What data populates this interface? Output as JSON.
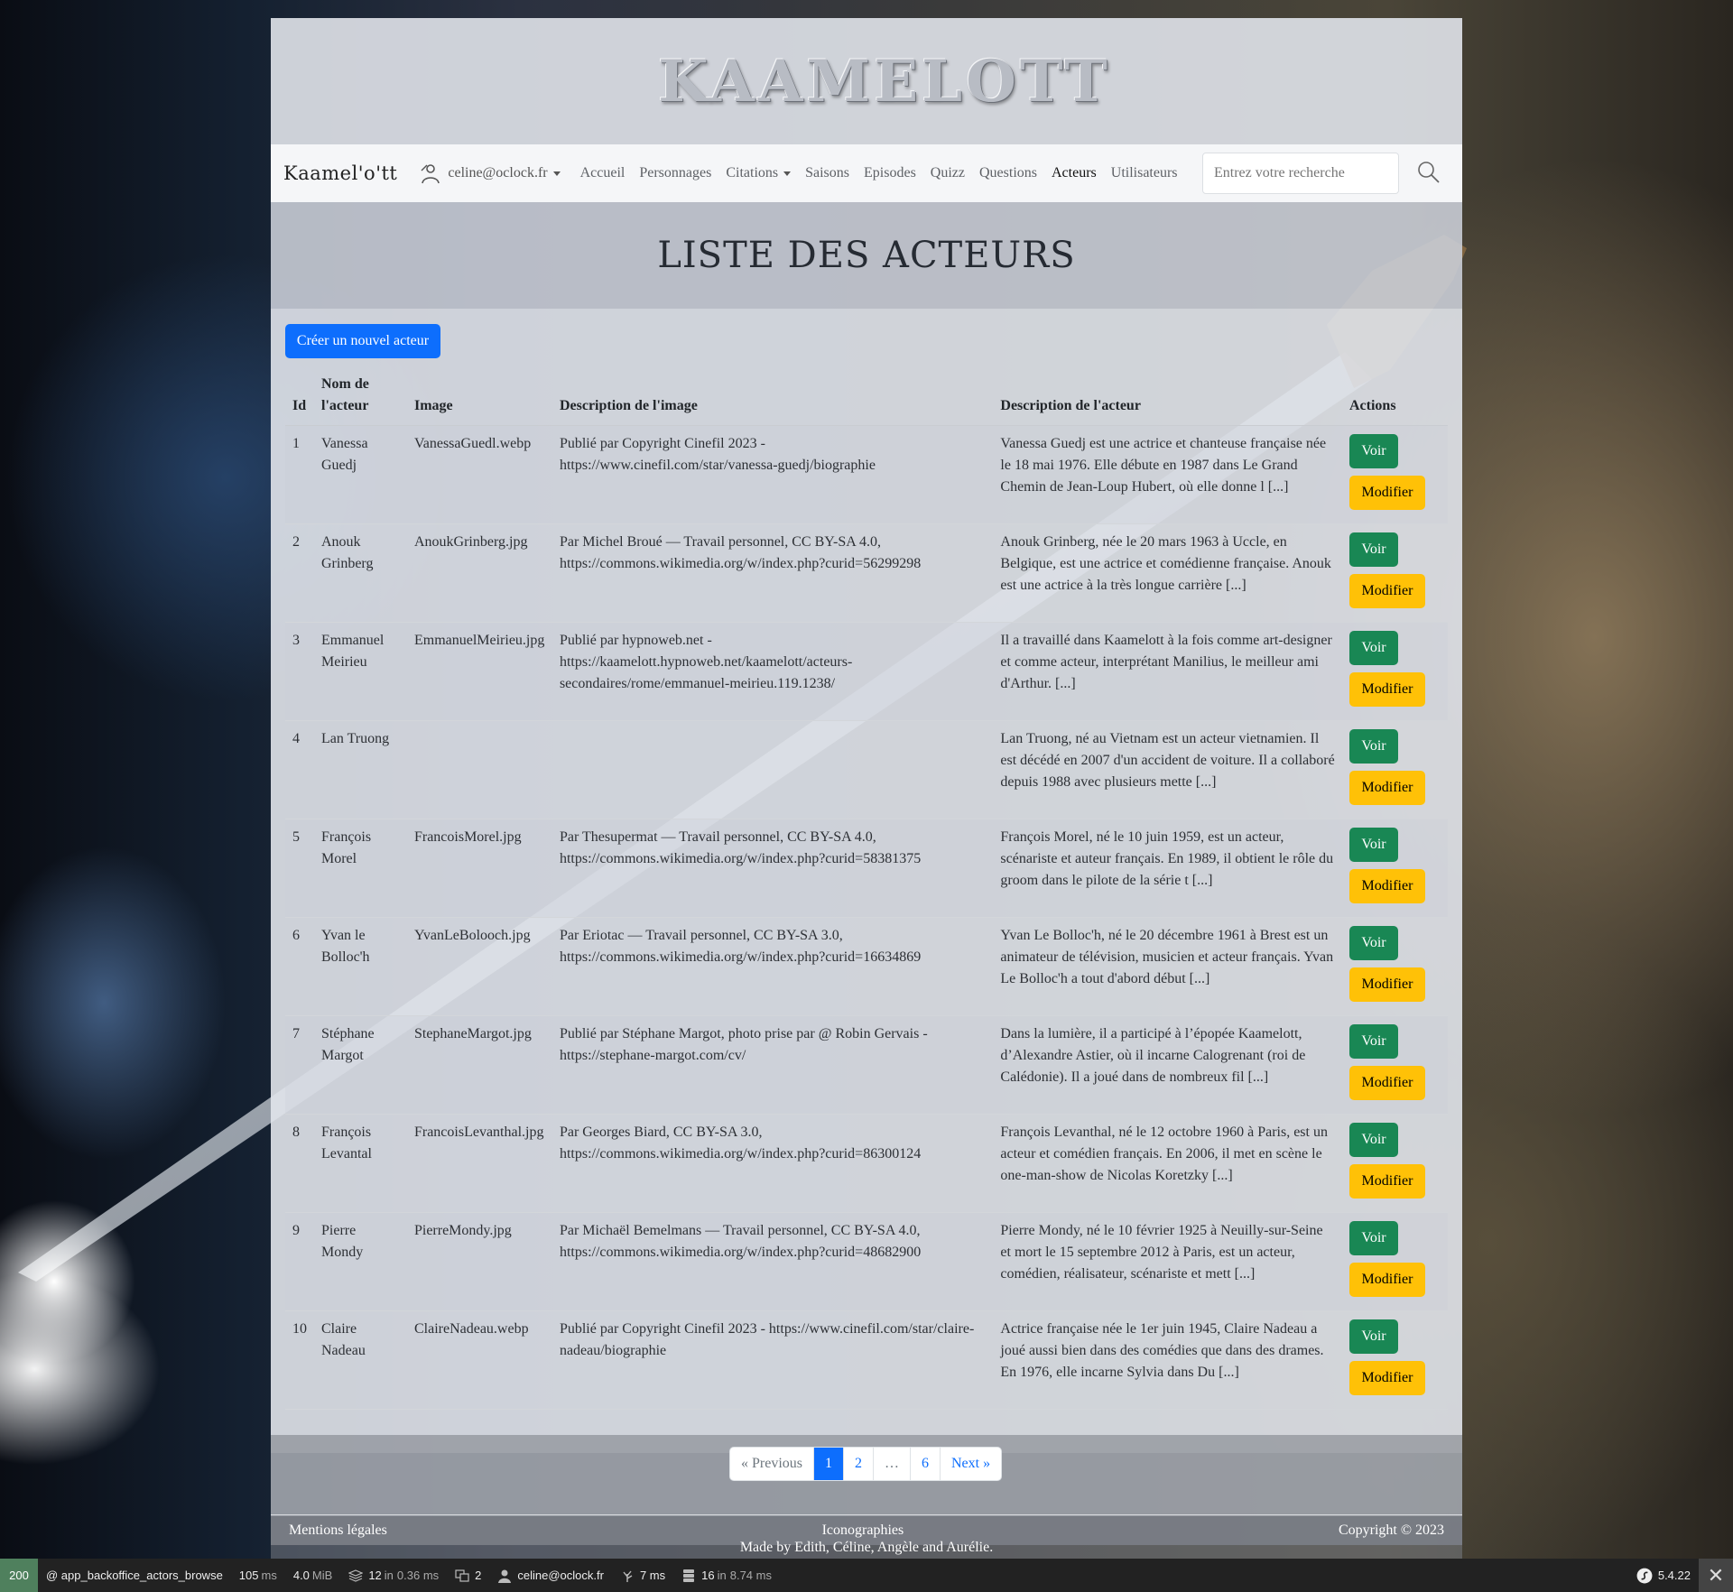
{
  "brand": {
    "logo_text": "KAAMELOTT",
    "nav_brand": "Kaamel'o'tt"
  },
  "navbar": {
    "user_email": "celine@oclock.fr",
    "links": [
      "Accueil",
      "Personnages",
      "Citations",
      "Saisons",
      "Episodes",
      "Quizz",
      "Questions",
      "Acteurs",
      "Utilisateurs"
    ],
    "active": "Acteurs",
    "search_placeholder": "Entrez votre recherche"
  },
  "page": {
    "title": "Liste des acteurs",
    "create_button": "Créer un nouvel acteur"
  },
  "table": {
    "headers": [
      "Id",
      "Nom de l'acteur",
      "Image",
      "Description de l'image",
      "Description de l'acteur",
      "Actions"
    ],
    "rows": [
      {
        "id": "1",
        "name": "Vanessa Guedj",
        "image": "VanessaGuedl.webp",
        "image_desc": "Publié par Copyright Cinefil 2023 - https://www.cinefil.com/star/vanessa-guedj/biographie",
        "desc": "Vanessa Guedj est une actrice et chanteuse française née le 18 mai 1976. Elle débute en 1987 dans Le Grand Chemin de Jean-Loup Hubert, où elle donne l [...]"
      },
      {
        "id": "2",
        "name": "Anouk Grinberg",
        "image": "AnoukGrinberg.jpg",
        "image_desc": "Par Michel Broué — Travail personnel, CC BY-SA 4.0, https://commons.wikimedia.org/w/index.php?curid=56299298",
        "desc": "Anouk Grinberg, née le 20 mars 1963 à Uccle, en Belgique, est une actrice et comédienne française. Anouk est une actrice à la très longue carrière [...]"
      },
      {
        "id": "3",
        "name": "Emmanuel Meirieu",
        "image": "EmmanuelMeirieu.jpg",
        "image_desc": "Publié par hypnoweb.net - https://kaamelott.hypnoweb.net/kaamelott/acteurs-secondaires/rome/emmanuel-meirieu.119.1238/",
        "desc": "Il a travaillé dans Kaamelott à la fois comme art-designer et comme acteur, interprétant Manilius, le meilleur ami d'Arthur. [...]"
      },
      {
        "id": "4",
        "name": "Lan Truong",
        "image": "",
        "image_desc": "",
        "desc": "Lan Truong, né au Vietnam est un acteur vietnamien. Il est décédé en 2007 d'un accident de voiture. Il a collaboré depuis 1988 avec plusieurs mette [...]"
      },
      {
        "id": "5",
        "name": "François Morel",
        "image": "FrancoisMorel.jpg",
        "image_desc": "Par Thesupermat — Travail personnel, CC BY-SA 4.0, https://commons.wikimedia.org/w/index.php?curid=58381375",
        "desc": "François Morel, né le 10 juin 1959, est un acteur, scénariste et auteur français. En 1989, il obtient le rôle du groom dans le pilote de la série t [...]"
      },
      {
        "id": "6",
        "name": "Yvan le Bolloc'h",
        "image": "YvanLeBolooch.jpg",
        "image_desc": "Par Eriotac — Travail personnel, CC BY-SA 3.0, https://commons.wikimedia.org/w/index.php?curid=16634869",
        "desc": "Yvan Le Bolloc'h, né le 20 décembre 1961 à Brest est un animateur de télévision, musicien et acteur français. Yvan Le Bolloc'h a tout d'abord début [...]"
      },
      {
        "id": "7",
        "name": "Stéphane Margot",
        "image": "StephaneMargot.jpg",
        "image_desc": "Publié par Stéphane Margot, photo prise par @ Robin Gervais - https://stephane-margot.com/cv/",
        "desc": "Dans la lumière, il a participé à l’épopée Kaamelott, d’Alexandre Astier, où il incarne Calogrenant (roi de Calédonie). Il a joué dans de nombreux fil [...]"
      },
      {
        "id": "8",
        "name": "François Levantal",
        "image": "FrancoisLevanthal.jpg",
        "image_desc": "Par Georges Biard, CC BY-SA 3.0, https://commons.wikimedia.org/w/index.php?curid=86300124",
        "desc": "François Levanthal, né le 12 octobre 1960 à Paris, est un acteur et comédien français. En 2006, il met en scène le one-man-show de Nicolas Koretzky [...]"
      },
      {
        "id": "9",
        "name": "Pierre Mondy",
        "image": "PierreMondy.jpg",
        "image_desc": "Par Michaël Bemelmans — Travail personnel, CC BY-SA 4.0, https://commons.wikimedia.org/w/index.php?curid=48682900",
        "desc": "Pierre Mondy, né le 10 février 1925 à Neuilly-sur-Seine et mort le 15 septembre 2012 à Paris, est un acteur, comédien, réalisateur, scénariste et mett [...]"
      },
      {
        "id": "10",
        "name": "Claire Nadeau",
        "image": "ClaireNadeau.webp",
        "image_desc": "Publié par Copyright Cinefil 2023 - https://www.cinefil.com/star/claire-nadeau/biographie",
        "desc": "Actrice française née le 1er juin 1945, Claire Nadeau a joué aussi bien dans des comédies que dans des drames. En 1976, elle incarne Sylvia dans Du [...]"
      }
    ],
    "voir_label": "Voir",
    "modifier_label": "Modifier"
  },
  "pagination": {
    "previous": "« Previous",
    "pages": [
      "1",
      "2",
      "…",
      "6"
    ],
    "current": "1",
    "next": "Next »"
  },
  "footer": {
    "legal": "Mentions légales",
    "icons": "Iconographies",
    "copyright": "Copyright © 2023",
    "credits": "Made by Edith, Céline, Angèle and Aurélie."
  },
  "debug_toolbar": {
    "status": "200",
    "route": "@ app_backoffice_actors_browse",
    "time": "105",
    "time_unit": "ms",
    "memory": "4.0",
    "memory_unit": "MiB",
    "forms_count": "12",
    "forms_in": "in",
    "forms_time": "0.36 ms",
    "translations": "2",
    "user": "celine@oclock.fr",
    "twig_time": "7 ms",
    "db_count": "16",
    "db_in": "in",
    "db_time": "8.74 ms",
    "version": "5.4.22"
  },
  "colors": {
    "primary": "#0d6efd",
    "success": "#198754",
    "warning": "#ffc107",
    "toolbar_status": "#4f805d"
  }
}
